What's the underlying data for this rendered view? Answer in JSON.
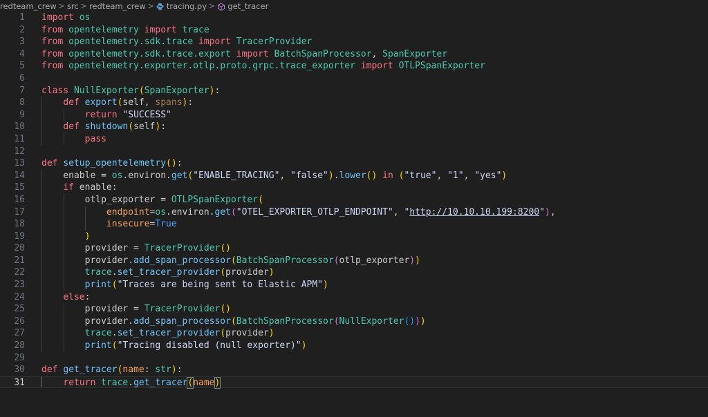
{
  "breadcrumb": {
    "items": [
      "redteam_crew",
      "src",
      "redteam_crew",
      "tracing.py",
      "get_tracer"
    ],
    "separator": ">"
  },
  "editor": {
    "current_line": 31,
    "lines": [
      {
        "n": "1"
      },
      {
        "n": "2"
      },
      {
        "n": "3"
      },
      {
        "n": "4"
      },
      {
        "n": "5"
      },
      {
        "n": "6"
      },
      {
        "n": "7"
      },
      {
        "n": "8"
      },
      {
        "n": "9"
      },
      {
        "n": "10"
      },
      {
        "n": "11"
      },
      {
        "n": "12"
      },
      {
        "n": "13"
      },
      {
        "n": "14"
      },
      {
        "n": "15"
      },
      {
        "n": "16"
      },
      {
        "n": "17"
      },
      {
        "n": "18"
      },
      {
        "n": "19"
      },
      {
        "n": "20"
      },
      {
        "n": "21"
      },
      {
        "n": "22"
      },
      {
        "n": "23"
      },
      {
        "n": "24"
      },
      {
        "n": "25"
      },
      {
        "n": "26"
      },
      {
        "n": "27"
      },
      {
        "n": "28"
      },
      {
        "n": "29"
      },
      {
        "n": "30"
      },
      {
        "n": "31"
      }
    ],
    "code": [
      "import os",
      "from opentelemetry import trace",
      "from opentelemetry.sdk.trace import TracerProvider",
      "from opentelemetry.sdk.trace.export import BatchSpanProcessor, SpanExporter",
      "from opentelemetry.exporter.otlp.proto.grpc.trace_exporter import OTLPSpanExporter",
      "",
      "class NullExporter(SpanExporter):",
      "    def export(self, spans):",
      "        return \"SUCCESS\"",
      "    def shutdown(self):",
      "        pass",
      "",
      "def setup_opentelemetry():",
      "    enable = os.environ.get(\"ENABLE_TRACING\", \"false\").lower() in (\"true\", \"1\", \"yes\")",
      "    if enable:",
      "        otlp_exporter = OTLPSpanExporter(",
      "            endpoint=os.environ.get(\"OTEL_EXPORTER_OTLP_ENDPOINT\", \"http://10.10.10.199:8200\"),",
      "            insecure=True",
      "        )",
      "        provider = TracerProvider()",
      "        provider.add_span_processor(BatchSpanProcessor(otlp_exporter))",
      "        trace.set_tracer_provider(provider)",
      "        print(\"Traces are being sent to Elastic APM\")",
      "    else:",
      "        provider = TracerProvider()",
      "        provider.add_span_processor(BatchSpanProcessor(NullExporter()))",
      "        trace.set_tracer_provider(provider)",
      "        print(\"Tracing disabled (null exporter)\")",
      "",
      "def get_tracer(name: str):",
      "    return trace.get_tracer(name)"
    ]
  },
  "colors": {
    "background": "#1f1f1f",
    "keyword": "#f97583",
    "function": "#6fc3f7",
    "class": "#4ec9b0",
    "bracket_gold": "#ffd700",
    "bracket_orchid": "#da70d6",
    "bracket_blue": "#179fff"
  }
}
